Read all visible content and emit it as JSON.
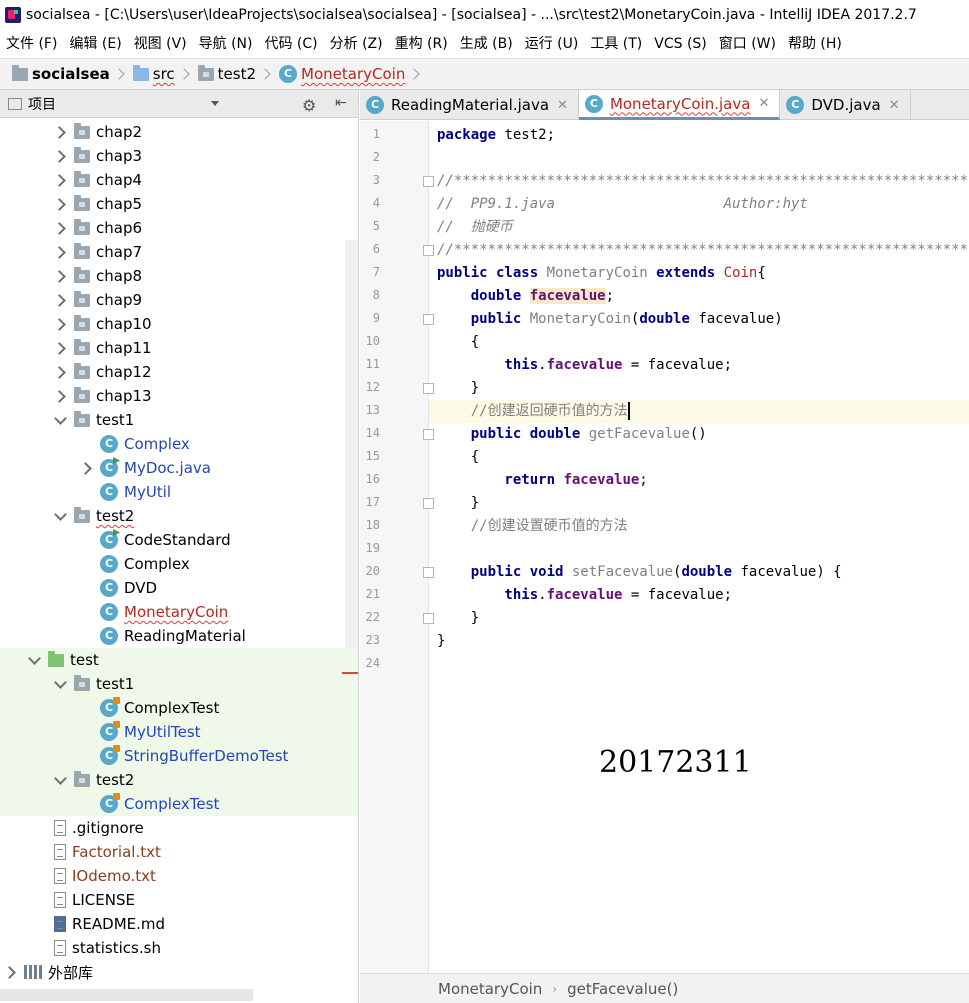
{
  "window": {
    "title": "socialsea - [C:\\Users\\user\\IdeaProjects\\socialsea\\socialsea] - [socialsea] - ...\\src\\test2\\MonetaryCoin.java - IntelliJ IDEA 2017.2.7"
  },
  "menu": [
    "文件 (F)",
    "编辑 (E)",
    "视图 (V)",
    "导航 (N)",
    "代码 (C)",
    "分析 (Z)",
    "重构 (R)",
    "生成 (B)",
    "运行 (U)",
    "工具 (T)",
    "VCS (S)",
    "窗口 (W)",
    "帮助 (H)"
  ],
  "navbar": {
    "project": "socialsea",
    "src": "src",
    "package": "test2",
    "file": "MonetaryCoin"
  },
  "project_panel": {
    "header": "项目",
    "tree": [
      {
        "label": "chap2"
      },
      {
        "label": "chap3"
      },
      {
        "label": "chap4"
      },
      {
        "label": "chap5"
      },
      {
        "label": "chap6"
      },
      {
        "label": "chap7"
      },
      {
        "label": "chap8"
      },
      {
        "label": "chap9"
      },
      {
        "label": "chap10"
      },
      {
        "label": "chap11"
      },
      {
        "label": "chap12"
      },
      {
        "label": "chap13"
      },
      {
        "label": "test1"
      },
      {
        "label": "Complex"
      },
      {
        "label": "MyDoc.java"
      },
      {
        "label": "MyUtil"
      },
      {
        "label": "test2"
      },
      {
        "label": "CodeStandard"
      },
      {
        "label": "Complex"
      },
      {
        "label": "DVD"
      },
      {
        "label": "MonetaryCoin"
      },
      {
        "label": "ReadingMaterial"
      },
      {
        "label": "test"
      },
      {
        "label": "test1"
      },
      {
        "label": "ComplexTest"
      },
      {
        "label": "MyUtilTest"
      },
      {
        "label": "StringBufferDemoTest"
      },
      {
        "label": "test2"
      },
      {
        "label": "ComplexTest"
      },
      {
        "label": ".gitignore"
      },
      {
        "label": "Factorial.txt"
      },
      {
        "label": "IOdemo.txt"
      },
      {
        "label": "LICENSE"
      },
      {
        "label": "README.md"
      },
      {
        "label": "statistics.sh"
      },
      {
        "label": "外部库"
      }
    ]
  },
  "tabs": [
    {
      "label": "ReadingMaterial.java",
      "icon": "C"
    },
    {
      "label": "MonetaryCoin.java",
      "icon": "C"
    },
    {
      "label": "DVD.java",
      "icon": "C"
    }
  ],
  "editor": {
    "line_numbers": [
      "1",
      "2",
      "3",
      "4",
      "5",
      "6",
      "7",
      "8",
      "9",
      "10",
      "11",
      "12",
      "13",
      "14",
      "15",
      "16",
      "17",
      "18",
      "19",
      "20",
      "21",
      "22",
      "23",
      "24"
    ],
    "code": {
      "l1_kw": "package",
      "l1_rest": " test2;",
      "l3": "//******************************************************************************",
      "l4": "//  PP9.1.java                    Author:hyt",
      "l5": "//  抛硬币",
      "l6": "//******************************************************************************",
      "l7_kw": "public class",
      "l7_name": " MonetaryCoin ",
      "l7_kw2": "extends",
      "l7_parent": " Coin",
      "l7_end": "{",
      "l8_kw": "    double ",
      "l8_field": "facevalue",
      "l8_end": ";",
      "l9_kw": "    public",
      "l9_name": " MonetaryCoin",
      "l9_open": "(",
      "l9_kw2": "double",
      "l9_param": " facevalue",
      "l9_close": ")",
      "l10": "    {",
      "l11_kw": "        this",
      "l11_dot": ".",
      "l11_field": "facevalue",
      "l11_rest": " = facevalue;",
      "l12": "    }",
      "l13": "    //创建返回硬币值的方法",
      "l14_kw": "    public double",
      "l14_name": " getFacevalue",
      "l14_rest": "()",
      "l15": "    {",
      "l16_kw": "        return ",
      "l16_field": "facevalue",
      "l16_end": ";",
      "l17": "    }",
      "l18": "    //创建设置硬币值的方法",
      "l20_kw": "    public void",
      "l20_name": " setFacevalue",
      "l20_open": "(",
      "l20_kw2": "double",
      "l20_param": " facevalue",
      "l20_end": ") {",
      "l21_kw": "        this",
      "l21_dot": ".",
      "l21_field": "facevalue",
      "l21_rest": " = facevalue;",
      "l22": "    }",
      "l23": "}"
    },
    "watermark": "20172311"
  },
  "code_breadcrumb": {
    "class": "MonetaryCoin",
    "method": "getFacevalue()"
  }
}
